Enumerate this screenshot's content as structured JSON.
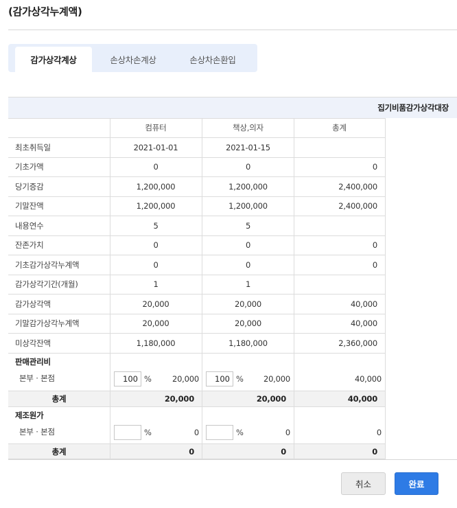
{
  "page": {
    "title": "(감가상각누계액)"
  },
  "tabs": [
    {
      "label": "감가상각계상",
      "active": true
    },
    {
      "label": "손상차손계상",
      "active": false
    },
    {
      "label": "손상차손환입",
      "active": false
    }
  ],
  "ledger": {
    "title": "집기비품감가상각대장",
    "columns": [
      "컴퓨터",
      "책상,의자",
      "총계"
    ],
    "rows": [
      {
        "label": "최초취득일",
        "c1": "2021-01-01",
        "c2": "2021-01-15",
        "total": ""
      },
      {
        "label": "기초가액",
        "c1": "0",
        "c2": "0",
        "total": "0"
      },
      {
        "label": "당기증감",
        "c1": "1,200,000",
        "c2": "1,200,000",
        "total": "2,400,000"
      },
      {
        "label": "기말잔액",
        "c1": "1,200,000",
        "c2": "1,200,000",
        "total": "2,400,000"
      },
      {
        "label": "내용연수",
        "c1": "5",
        "c2": "5",
        "total": ""
      },
      {
        "label": "잔존가치",
        "c1": "0",
        "c2": "0",
        "total": "0"
      },
      {
        "label": "기초감가상각누계액",
        "c1": "0",
        "c2": "0",
        "total": "0"
      },
      {
        "label": "감가상각기간(개월)",
        "c1": "1",
        "c2": "1",
        "total": ""
      },
      {
        "label": "감가상각액",
        "c1": "20,000",
        "c2": "20,000",
        "total": "40,000"
      },
      {
        "label": "기말감가상각누계액",
        "c1": "20,000",
        "c2": "20,000",
        "total": "40,000"
      },
      {
        "label": "미상각잔액",
        "c1": "1,180,000",
        "c2": "1,180,000",
        "total": "2,360,000"
      }
    ]
  },
  "sga": {
    "title": "판매관리비",
    "row_label": "본부 · 본점",
    "c1_pct": "100",
    "c1_amt": "20,000",
    "c2_pct": "100",
    "c2_amt": "20,000",
    "total_amt": "40,000",
    "pct_symbol": "%",
    "sum_label": "총계",
    "sum_c1": "20,000",
    "sum_c2": "20,000",
    "sum_total": "40,000"
  },
  "mfg": {
    "title": "제조원가",
    "row_label": "본부 · 본점",
    "c1_pct": "",
    "c1_amt": "0",
    "c2_pct": "",
    "c2_amt": "0",
    "total_amt": "0",
    "pct_symbol": "%",
    "sum_label": "총계",
    "sum_c1": "0",
    "sum_c2": "0",
    "sum_total": "0"
  },
  "buttons": {
    "cancel": "취소",
    "ok": "완료"
  },
  "colors": {
    "accent": "#2e7be5",
    "tab_bg": "#e8effb",
    "header_band": "#eef2fa",
    "total_band": "#f2f2f2"
  }
}
